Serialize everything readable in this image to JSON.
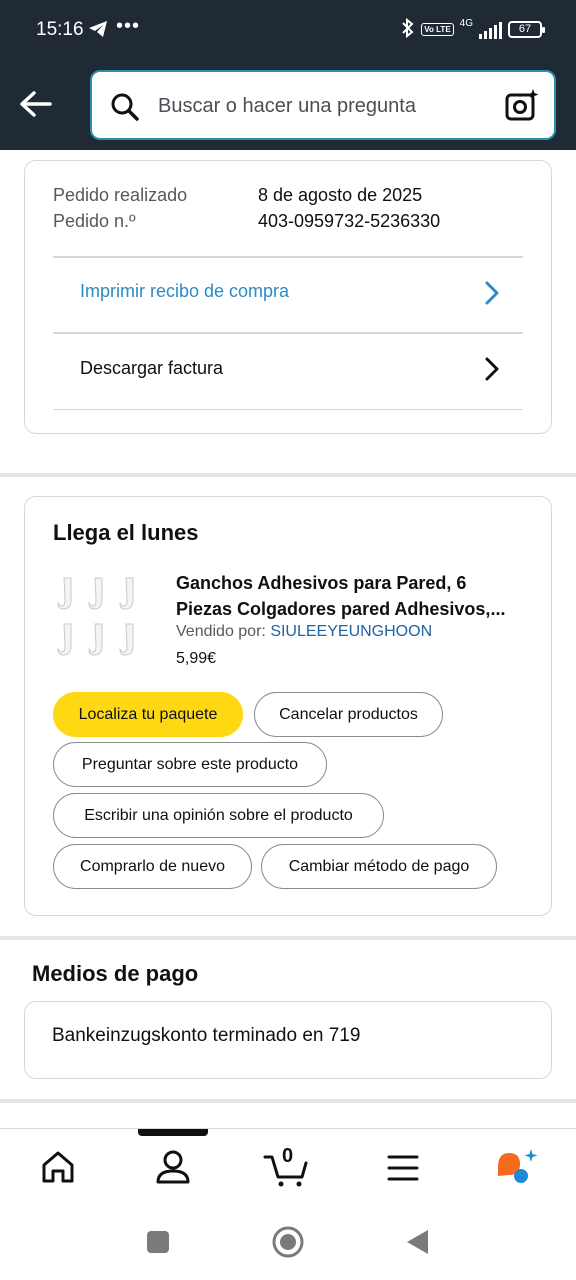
{
  "status_bar": {
    "time": "15:16",
    "dots": "•••",
    "network": "4G",
    "volte": "Vo LTE",
    "battery": "67"
  },
  "header": {
    "search_placeholder": "Buscar o hacer una pregunta"
  },
  "order_info": {
    "placed_label": "Pedido realizado",
    "placed_value": "8 de agosto de 2025",
    "number_label": "Pedido n.º",
    "number_value": "403-0959732-5236330",
    "print_receipt": "Imprimir recibo de compra",
    "download_invoice": "Descargar factura"
  },
  "shipment": {
    "title": "Llega el lunes",
    "product_title_line1": "Ganchos Adhesivos para Pared, 6",
    "product_title_line2": "Piezas Colgadores pared Adhesivos,...",
    "seller_label": "Vendido por:",
    "seller_name": "SIULEEYEUNGHOON",
    "price": "5,99€",
    "actions": {
      "track": "Localiza tu paquete",
      "cancel": "Cancelar productos",
      "ask": "Preguntar sobre este producto",
      "review": "Escribir una opinión sobre el producto",
      "buy_again": "Comprarlo de nuevo",
      "change_payment": "Cambiar método de pago"
    }
  },
  "payment": {
    "title": "Medios de pago",
    "method": "Bankeinzugskonto terminado en 719"
  },
  "bottom_nav": {
    "cart_count": "0"
  },
  "colors": {
    "header_bg": "#1f2a35",
    "link_blue": "#2162a1",
    "primary_button": "#ffd814",
    "rufus_orange": "#f56a1f",
    "rufus_blue": "#1e8ad3"
  }
}
